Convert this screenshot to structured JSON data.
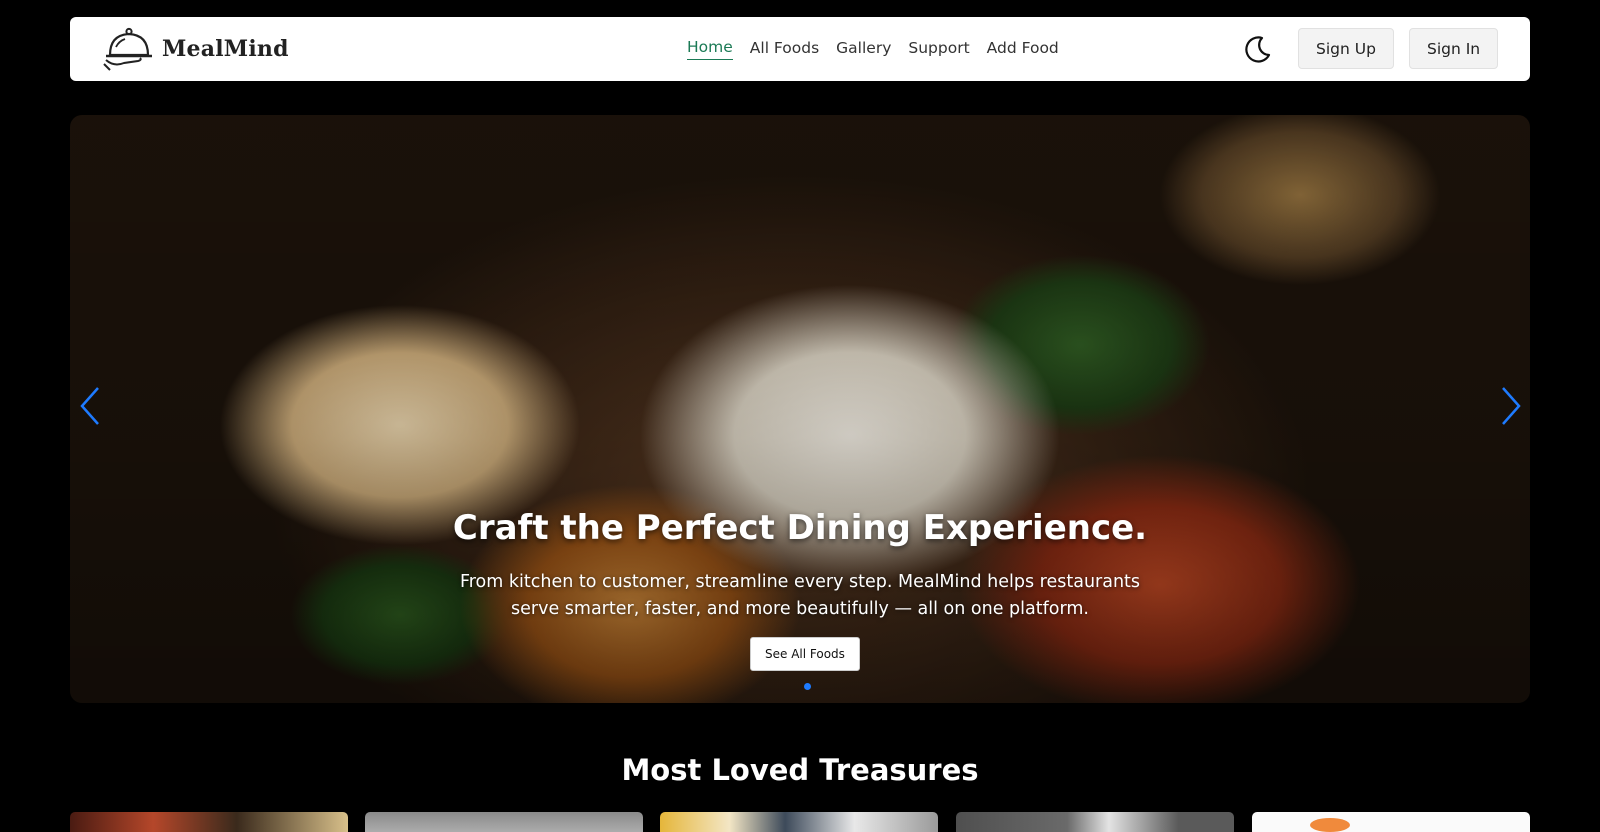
{
  "brand": {
    "name": "MealMind",
    "logo_icon": "cloche-icon"
  },
  "nav": {
    "links": [
      {
        "label": "Home",
        "active": true
      },
      {
        "label": "All Foods"
      },
      {
        "label": "Gallery"
      },
      {
        "label": "Support"
      },
      {
        "label": "Add Food"
      }
    ],
    "theme_toggle_icon": "moon-icon",
    "signup_label": "Sign Up",
    "signin_label": "Sign In",
    "active_color": "#1b7a55"
  },
  "hero": {
    "title": "Craft the Perfect Dining Experience.",
    "subtitle": "From kitchen to customer, streamline every step. MealMind helps restaurants serve smarter, faster, and more beautifully — all on one platform.",
    "cta_label": "See All Foods",
    "prev_icon": "chevron-left-icon",
    "next_icon": "chevron-right-icon",
    "slide_count": 1,
    "active_slide": 1,
    "accent_color": "#1e7bff"
  },
  "section": {
    "title": "Most Loved Treasures"
  }
}
